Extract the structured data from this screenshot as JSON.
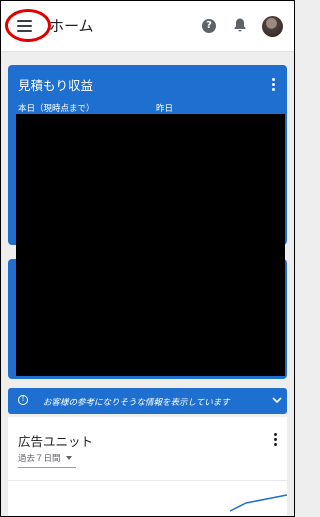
{
  "app_bar": {
    "title": "ホーム",
    "help_icon": "help-circle-icon",
    "bell_icon": "notifications-icon"
  },
  "estimated_revenue_card": {
    "title": "見積もり収益",
    "today_label": "本日（現時点まで）",
    "yesterday_label": "昨日"
  },
  "info_banner": {
    "text": "お客様の参考になりそうな情報を表示しています"
  },
  "ad_units_card": {
    "title": "広告ユニット",
    "period_selected": "過去７日間"
  },
  "colors": {
    "accent_blue": "#1f6fd1",
    "highlight_red": "#e00000"
  }
}
